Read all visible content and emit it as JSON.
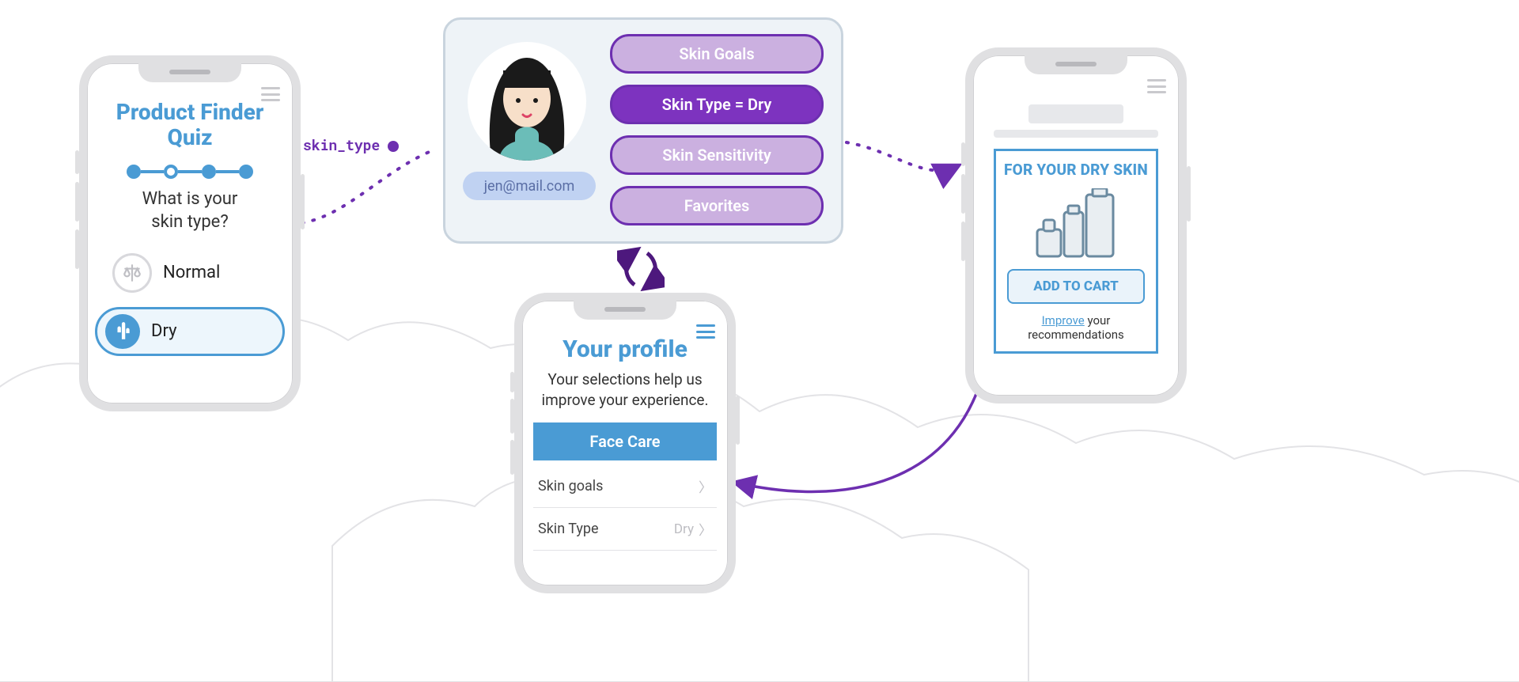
{
  "quiz": {
    "title_a": "Product Finder",
    "title_b": "Quiz",
    "question": "What is your\nskin type?",
    "options": {
      "normal": "Normal",
      "dry": "Dry"
    }
  },
  "flow": {
    "label": "skin_type"
  },
  "profile_card": {
    "email": "jen@mail.com",
    "attrs": {
      "goals": "Skin Goals",
      "type": "Skin Type = Dry",
      "sensitivity": "Skin Sensitivity",
      "favorites": "Favorites"
    }
  },
  "profile_phone": {
    "title": "Your profile",
    "subtitle": "Your selections help us improve your experience.",
    "tab": "Face Care",
    "rows": {
      "goals": {
        "label": "Skin goals",
        "value": ""
      },
      "type": {
        "label": "Skin Type",
        "value": "Dry"
      }
    }
  },
  "reco": {
    "heading": "FOR YOUR DRY SKIN",
    "cta": "ADD TO CART",
    "improve": "Improve",
    "foot_rest": " your recommendations"
  }
}
